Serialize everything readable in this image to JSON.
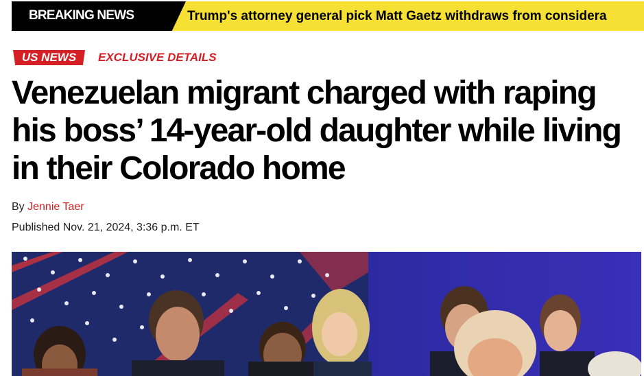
{
  "ticker": {
    "label": "BREAKING NEWS",
    "headline": "Trump's attorney general pick Matt Gaetz withdraws from considera"
  },
  "article": {
    "category": "US NEWS",
    "subcategory": "EXCLUSIVE DETAILS",
    "title": "Venezuelan migrant charged with raping his boss’ 14-year-old daughter while living in their Colorado home",
    "byline_prefix": "By",
    "author": "Jennie Taer",
    "published": "Published Nov. 21, 2024, 3:36 p.m. ET"
  },
  "colors": {
    "ticker_bg": "#f6e033",
    "accent_red": "#d41f25",
    "hero_blue": "#1c2a7a"
  },
  "icons": [
    "flag-stars-image"
  ]
}
